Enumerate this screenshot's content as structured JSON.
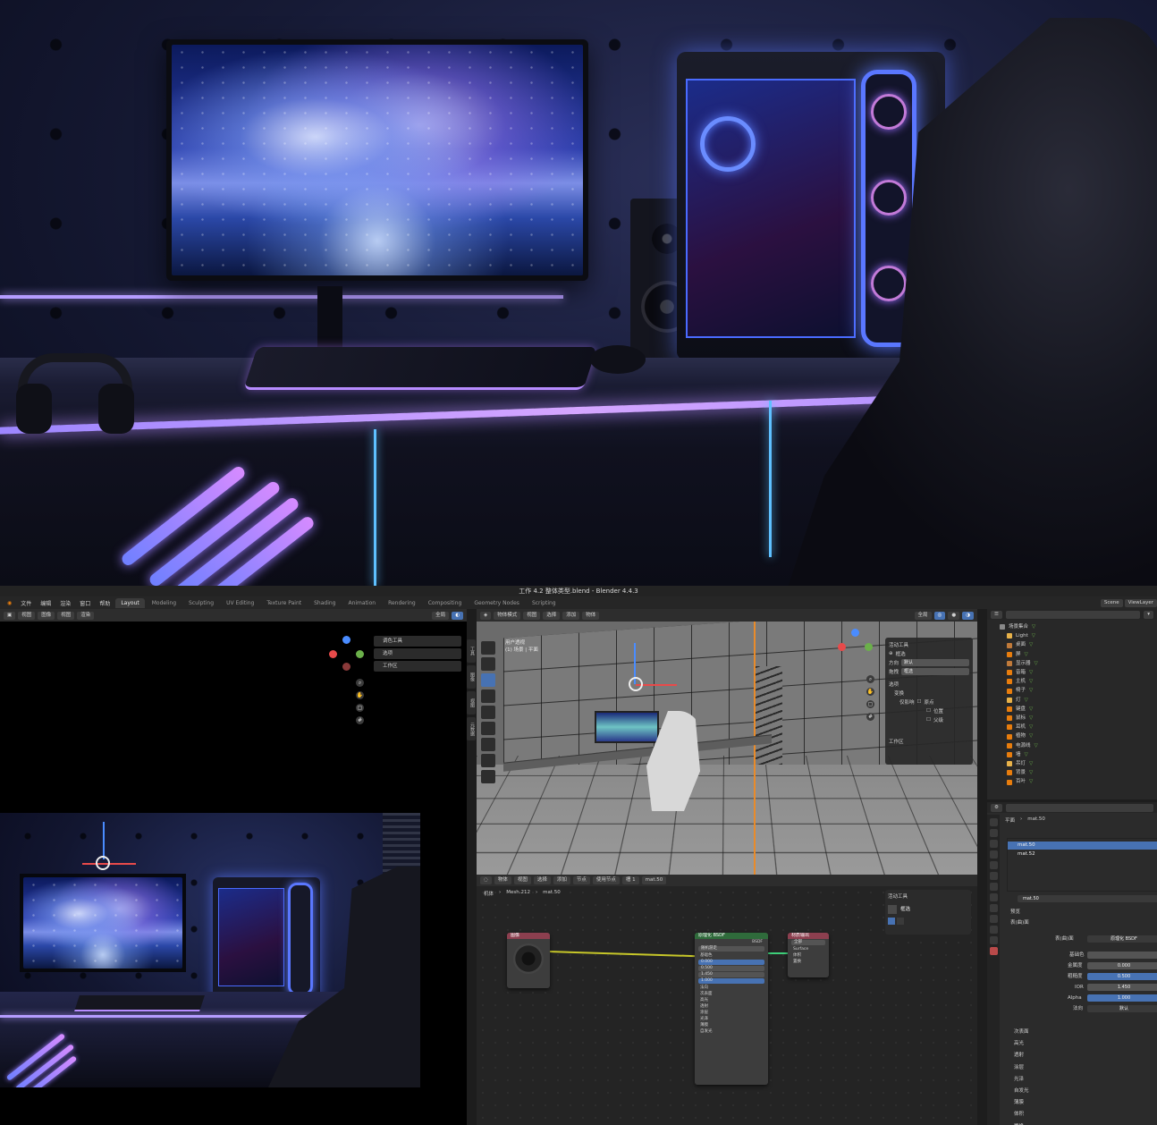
{
  "window": {
    "title": "工作 4.2 整体类型.blend - Blender 4.4.3"
  },
  "menu": {
    "items": [
      "文件",
      "编辑",
      "渲染",
      "窗口",
      "帮助"
    ]
  },
  "workspaces": {
    "tabs": [
      "Layout",
      "Modeling",
      "Sculpting",
      "UV Editing",
      "Texture Paint",
      "Shading",
      "Animation",
      "Rendering",
      "Compositing",
      "Geometry Nodes",
      "Scripting"
    ],
    "active": "Layout"
  },
  "scene": {
    "name": "Scene",
    "view_layer": "ViewLayer"
  },
  "image_editor": {
    "header": [
      "视图",
      "图像",
      "视图",
      "渲染"
    ],
    "panel_tabs": [
      "调色工具",
      "选项",
      "工作区"
    ],
    "view_tabs": [
      "工具",
      "图像",
      "视图",
      "元数据"
    ]
  },
  "viewport": {
    "header": [
      "物体模式",
      "视图",
      "选择",
      "添加",
      "物体"
    ],
    "transform_orientation": "全局",
    "view_label": "用户透视",
    "collection_label": "(1) 场景 | 平面",
    "npanel": {
      "tool_title": "活动工具",
      "select_label": "框选",
      "orientation_label": "方向",
      "orientation_value": "默认",
      "drag_label": "拖拽",
      "drag_value": "框选",
      "options_title": "选项",
      "transform_title": "变换",
      "affect_label": "仅影响",
      "origin_label": "原点",
      "location_label": "位置",
      "parents_label": "父级",
      "workspace_title": "工作区"
    }
  },
  "shader_editor": {
    "header": [
      "物体",
      "视图",
      "选择",
      "添加",
      "节点",
      "使用节点"
    ],
    "slot": "槽 1",
    "material": "mat.50",
    "breadcrumb": [
      "机体",
      "Mesh.212",
      "mat.50"
    ],
    "tool_panel_title": "活动工具",
    "tool_select": "框选",
    "nodes": {
      "image": {
        "title": "图像"
      },
      "bsdf": {
        "title": "原理化 BSDF",
        "rows": [
          "BSDF",
          "基础色",
          "金属度",
          "粗糙度",
          "IOR",
          "Alpha",
          "法向",
          "次表面",
          "高光",
          "透射",
          "涂层",
          "光泽",
          "薄膜",
          "自发光"
        ],
        "fields": [
          "随机游走",
          "0.000",
          "0.500",
          "1.450",
          "1.000"
        ]
      },
      "output": {
        "title": "材质输出",
        "rows": [
          "全部",
          "Surface",
          "体积",
          "置换",
          "厚度"
        ]
      }
    }
  },
  "outliner": {
    "search_placeholder": "",
    "rows": [
      "场景集合",
      "Light",
      "桌面",
      "屏",
      "显示器",
      "音箱",
      "主机",
      "椅子",
      "灯",
      "键盘",
      "鼠标",
      "耳机",
      "植物",
      "电源线",
      "墙",
      "吊灯",
      "背景",
      "百叶"
    ]
  },
  "properties": {
    "breadcrumb": [
      "平面",
      "mat.50"
    ],
    "slots": [
      "mat.50",
      "mat.52"
    ],
    "material_name": "mat.50",
    "sections": {
      "preview": "预览",
      "surface": "表(曲)面",
      "surface_shader": "原理化 BSDF",
      "base_color_label": "基础色",
      "metallic_label": "金属度",
      "metallic_value": "0.000",
      "roughness_label": "粗糙度",
      "roughness_value": "0.500",
      "ior_label": "IOR",
      "ior_value": "1.450",
      "alpha_label": "Alpha",
      "alpha_value": "1.000",
      "normal_label": "法向",
      "normal_value": "默认",
      "lower": [
        "次表面",
        "高光",
        "透射",
        "涂层",
        "光泽",
        "自发光",
        "薄膜",
        "体积",
        "置换"
      ]
    }
  },
  "colors": {
    "accent_blue": "#4772b3",
    "blender_bg": "#1d1d1d",
    "x_axis": "#e84a4a",
    "y_axis": "#6bb04a",
    "z_axis": "#4a8cff",
    "neon_purple": "#b68cff",
    "neon_blue": "#5a77ff"
  }
}
